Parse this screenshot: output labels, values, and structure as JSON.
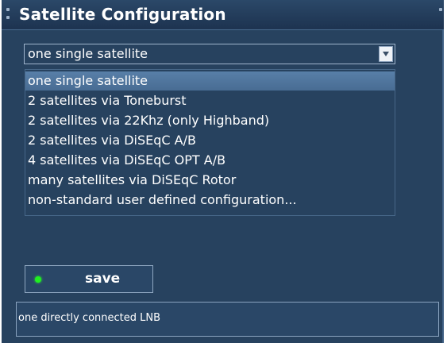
{
  "window": {
    "title": "Satellite Configuration"
  },
  "select": {
    "current_value": "one single satellite",
    "options": [
      "one single satellite",
      "2 satellites via Toneburst",
      "2 satellites via 22Khz (only Highband)",
      "2 satellites via DiSEqC A/B",
      "4 satellites via DiSEqC OPT A/B",
      "many satellites via DiSEqC Rotor",
      "non-standard user defined configuration..."
    ],
    "highlighted_index": 0
  },
  "save_button": {
    "label": "save",
    "indicator_color": "#20f020"
  },
  "status": {
    "text": "one directly connected LNB"
  },
  "colors": {
    "background": "#27425f",
    "highlight": "#587fa8",
    "border": "#9fb4cc"
  },
  "icons": {
    "dropdown_arrow": "chevron-down-icon"
  }
}
